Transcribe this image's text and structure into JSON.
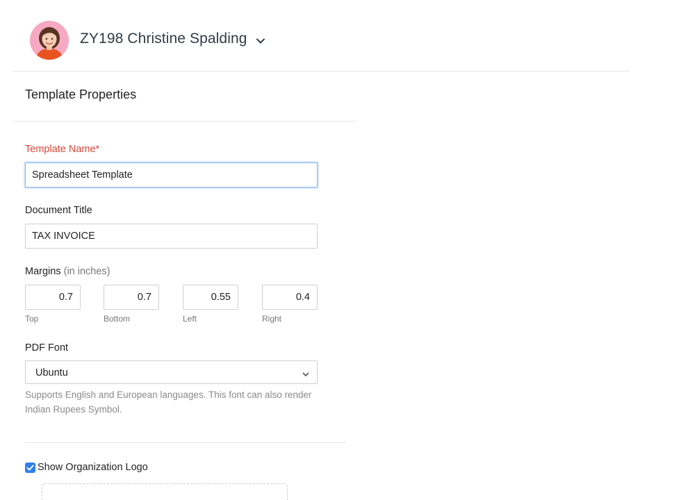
{
  "header": {
    "org_name": "ZY198 Christine Spalding",
    "avatar_icon": "user-avatar",
    "chevron_icon": "chevron-down-icon"
  },
  "panel": {
    "title": "Template Properties"
  },
  "form": {
    "template_name": {
      "label": "Template Name*",
      "value": "Spreadsheet Template"
    },
    "document_title": {
      "label": "Document Title",
      "value": "TAX INVOICE"
    },
    "margins": {
      "label": "Margins",
      "unit_note": "(in inches)",
      "top": {
        "value": "0.7",
        "label": "Top"
      },
      "bottom": {
        "value": "0.7",
        "label": "Bottom"
      },
      "left": {
        "value": "0.55",
        "label": "Left"
      },
      "right": {
        "value": "0.4",
        "label": "Right"
      }
    },
    "pdf_font": {
      "label": "PDF Font",
      "selected": "Ubuntu",
      "help": "Supports English and European languages. This font can also render Indian Rupees Symbol."
    },
    "show_logo": {
      "label": "Show Organization Logo",
      "checked": true
    }
  },
  "colors": {
    "required_label": "#d9483b",
    "checkbox_accent": "#2f80ed",
    "focus_border": "#8ab6ea"
  }
}
